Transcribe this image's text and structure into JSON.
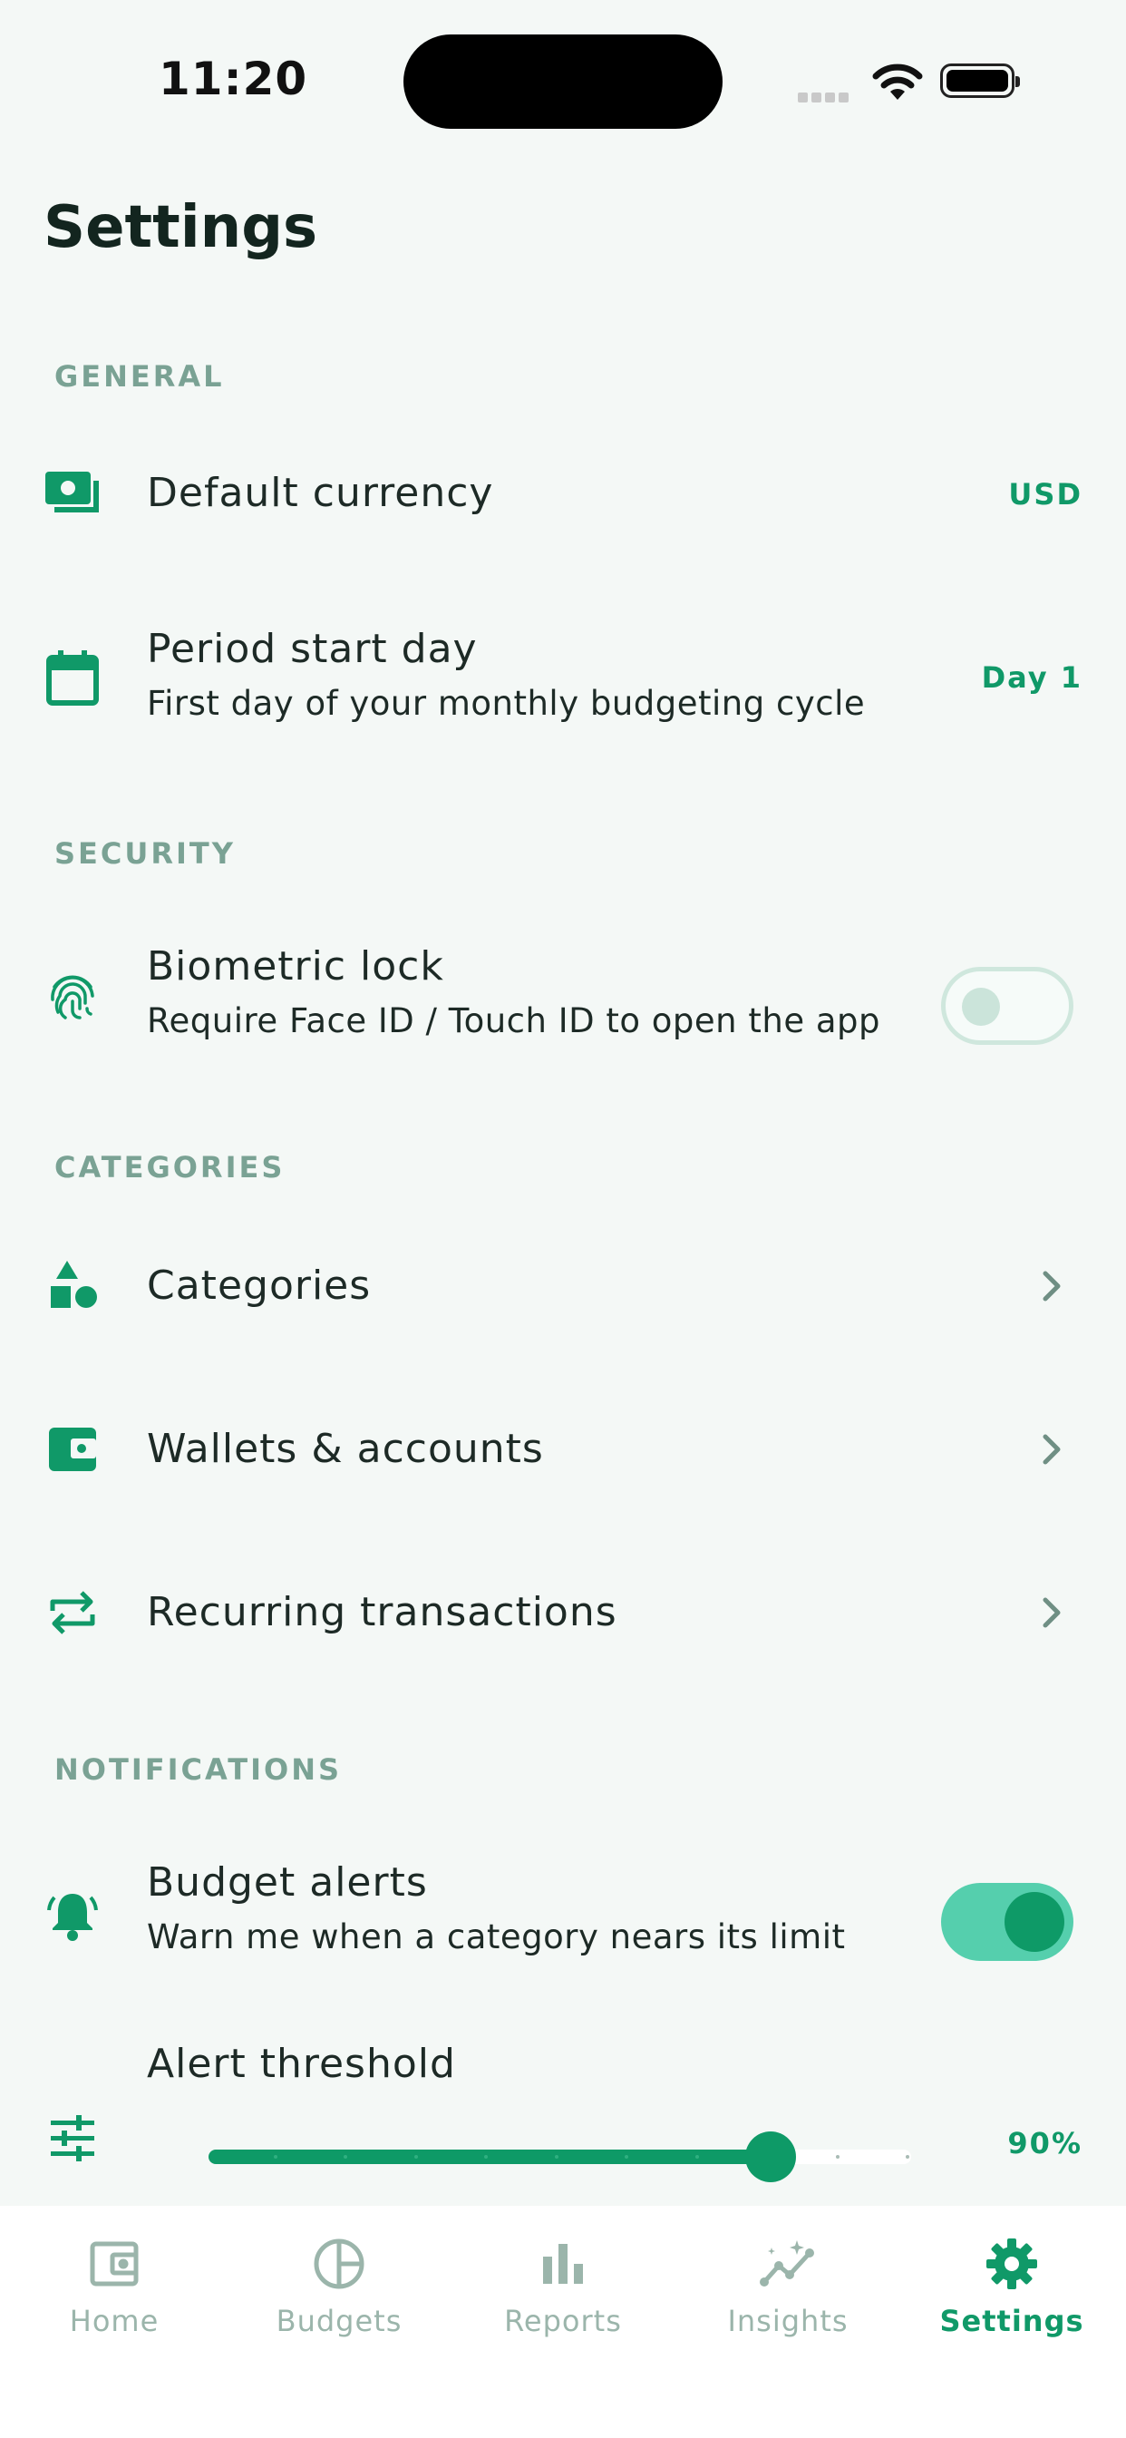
{
  "status_bar": {
    "time": "11:20"
  },
  "page": {
    "title": "Settings"
  },
  "sections": {
    "general": "GENERAL",
    "security": "SECURITY",
    "categories": "CATEGORIES",
    "notifications": "NOTIFICATIONS"
  },
  "general": {
    "currency": {
      "icon": "cash-icon",
      "title": "Default currency",
      "value": "USD"
    },
    "period": {
      "icon": "calendar-icon",
      "title": "Period start day",
      "subtitle": "First day of your monthly budgeting cycle",
      "value": "Day 1"
    }
  },
  "security": {
    "biometric": {
      "icon": "fingerprint-icon",
      "title": "Biometric lock",
      "subtitle": "Require Face ID / Touch ID to open the app",
      "enabled": false
    }
  },
  "categories": {
    "categories": {
      "icon": "shapes-icon",
      "title": "Categories"
    },
    "wallets": {
      "icon": "wallet-icon",
      "title": "Wallets & accounts"
    },
    "recurring": {
      "icon": "repeat-icon",
      "title": "Recurring transactions"
    }
  },
  "notifications": {
    "budget_alerts": {
      "icon": "bell-icon",
      "title": "Budget alerts",
      "subtitle": "Warn me when a category nears its limit",
      "enabled": true
    },
    "threshold": {
      "icon": "tune-icon",
      "title": "Alert threshold",
      "value": "90%",
      "level": 0.8
    }
  },
  "tabs": [
    {
      "label": "Home",
      "icon": "wallet-icon",
      "active": false
    },
    {
      "label": "Budgets",
      "icon": "pie-chart-icon",
      "active": false
    },
    {
      "label": "Reports",
      "icon": "bar-chart-icon",
      "active": false
    },
    {
      "label": "Insights",
      "icon": "insights-icon",
      "active": false
    },
    {
      "label": "Settings",
      "icon": "gear-icon",
      "active": true
    }
  ],
  "colors": {
    "accent": "#109968",
    "accent_light": "#55cfad",
    "section_label": "#7aa294",
    "background": "#f4f8f6"
  }
}
